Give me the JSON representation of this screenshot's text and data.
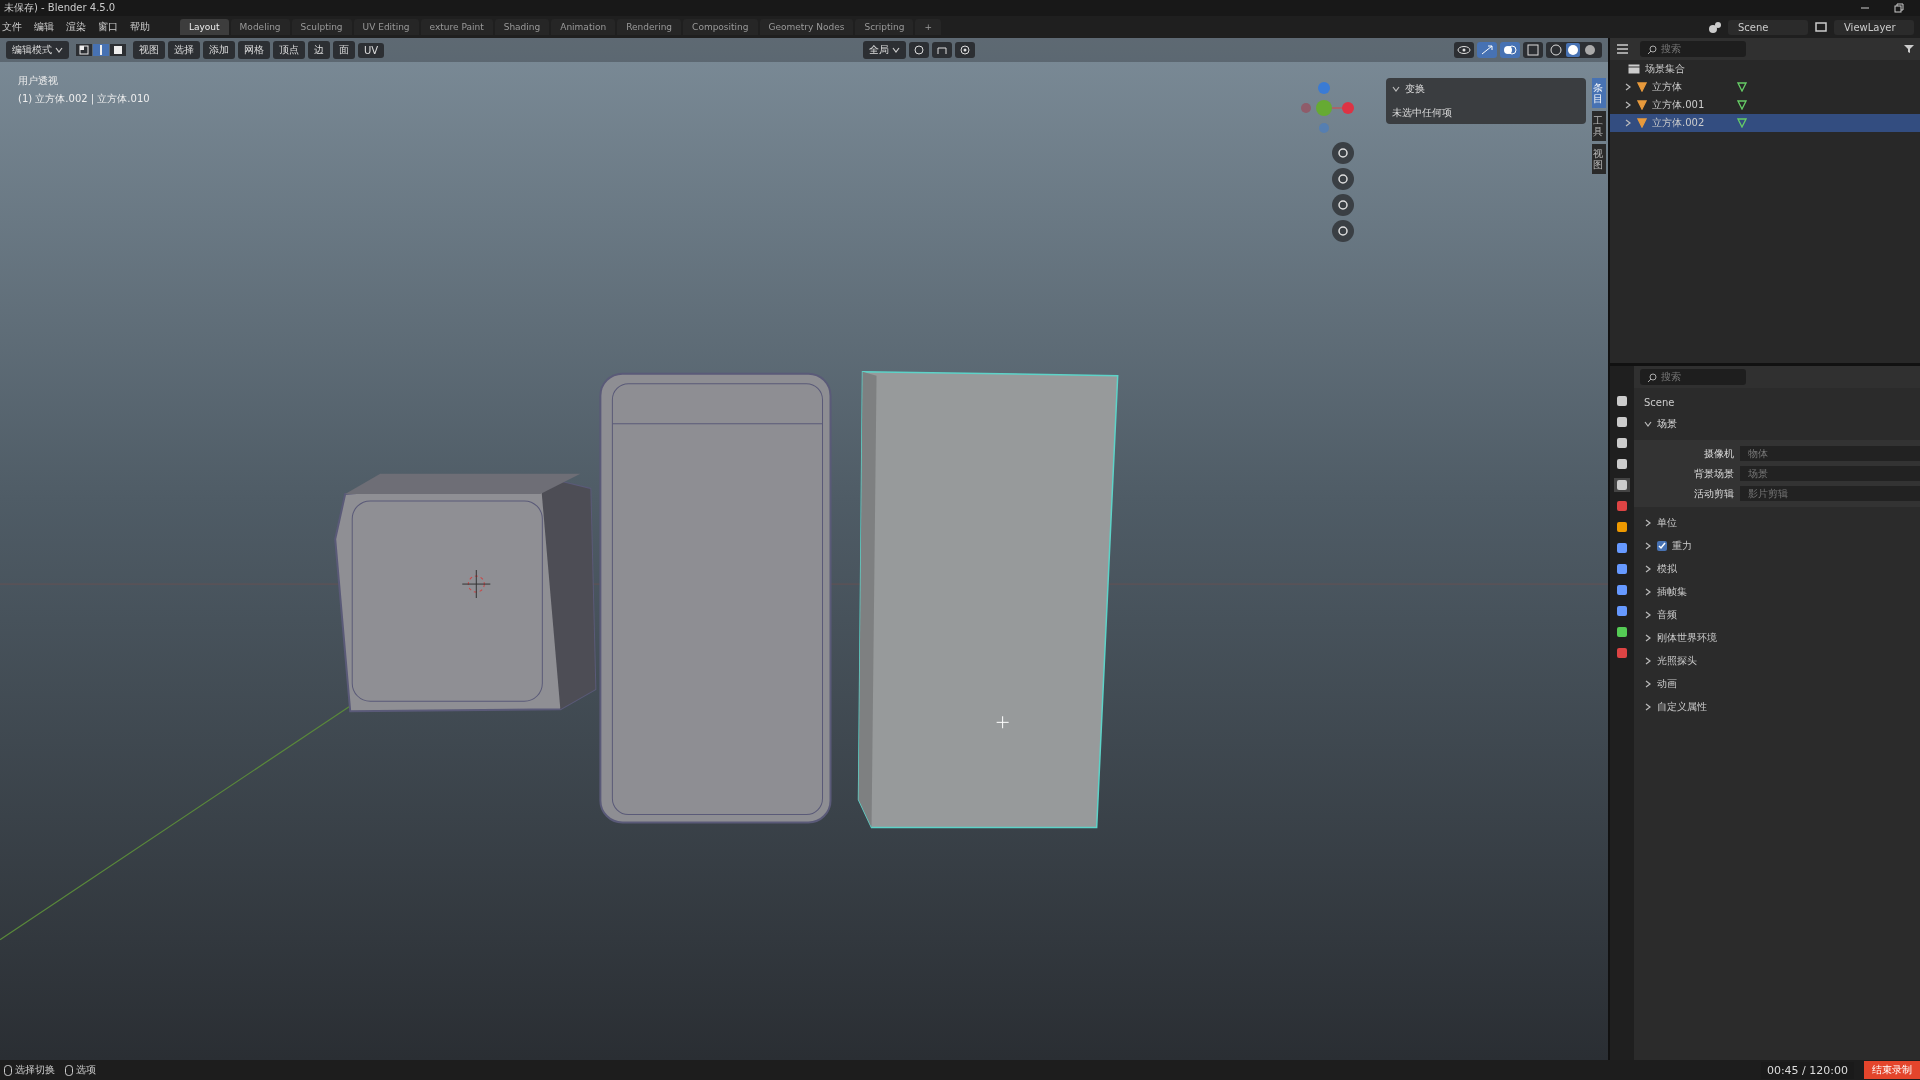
{
  "window": {
    "title": "未保存) - Blender 4.5.0"
  },
  "menu": [
    "文件",
    "编辑",
    "渲染",
    "窗口",
    "帮助"
  ],
  "workspace_tabs": [
    {
      "label": "Layout",
      "selected": true
    },
    {
      "label": "Modeling",
      "selected": false
    },
    {
      "label": "Sculpting",
      "selected": false
    },
    {
      "label": "UV Editing",
      "selected": false
    },
    {
      "label": "exture Paint",
      "selected": false
    },
    {
      "label": "Shading",
      "selected": false
    },
    {
      "label": "Animation",
      "selected": false
    },
    {
      "label": "Rendering",
      "selected": false
    },
    {
      "label": "Compositing",
      "selected": false
    },
    {
      "label": "Geometry Nodes",
      "selected": false
    },
    {
      "label": "Scripting",
      "selected": false
    }
  ],
  "add_tab": "+",
  "topbar_right": {
    "scene": "Scene",
    "view_layer": "ViewLayer"
  },
  "viewport_header": {
    "mode": "编辑模式",
    "select_modes": [
      {
        "kind": "vertex",
        "selected": false
      },
      {
        "kind": "edge",
        "selected": true
      },
      {
        "kind": "face",
        "selected": false
      }
    ],
    "menus": [
      "视图",
      "选择",
      "添加",
      "网格",
      "顶点",
      "边",
      "面",
      "UV"
    ],
    "orientation": "全局"
  },
  "viewport": {
    "view_name": "用户透视",
    "info": "(1) 立方体.002 | 立方体.010"
  },
  "sidebar_panel": {
    "title": "变换",
    "expanded": true,
    "message": "未选中任何项"
  },
  "sidebar_tabs": [
    {
      "label": "条目",
      "selected": true
    },
    {
      "label": "工具",
      "selected": false
    },
    {
      "label": "视图",
      "selected": false
    }
  ],
  "outliner": {
    "search_placeholder": "搜索",
    "collection": "场景集合",
    "items": [
      {
        "name": "立方体",
        "selected": false
      },
      {
        "name": "立方体.001",
        "selected": false
      },
      {
        "name": "立方体.002",
        "selected": true
      }
    ]
  },
  "properties": {
    "search_placeholder": "搜索",
    "context": "Scene",
    "section": {
      "title": "场景",
      "expanded": true,
      "fields": [
        {
          "label": "摄像机",
          "placeholder": "物体"
        },
        {
          "label": "背景场景",
          "placeholder": "场景"
        },
        {
          "label": "活动剪辑",
          "placeholder": "影片剪辑"
        }
      ]
    },
    "panels": [
      {
        "title": "单位",
        "kind": "plain"
      },
      {
        "title": "重力",
        "kind": "checkbox",
        "checked": true
      },
      {
        "title": "模拟",
        "kind": "plain"
      },
      {
        "title": "插帧集",
        "kind": "plain"
      },
      {
        "title": "音频",
        "kind": "plain"
      },
      {
        "title": "刚体世界环境",
        "kind": "plain"
      },
      {
        "title": "光照探头",
        "kind": "plain"
      },
      {
        "title": "动画",
        "kind": "plain"
      },
      {
        "title": "自定义属性",
        "kind": "plain"
      }
    ]
  },
  "status_bar": [
    "选择切换",
    "选项"
  ],
  "recording": {
    "time": "00:45 / 120:00",
    "button": "结束录制"
  }
}
